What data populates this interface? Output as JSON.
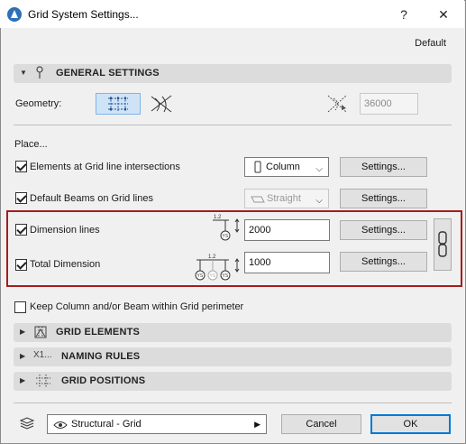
{
  "window": {
    "title": "Grid System Settings...",
    "help": "?",
    "close": "✕"
  },
  "header": {
    "favorite": "Default"
  },
  "general": {
    "section_label": "GENERAL SETTINGS",
    "geometry_label": "Geometry:",
    "angle_value": "36000"
  },
  "place": {
    "label": "Place...",
    "rows": [
      {
        "label": "Elements at Grid line intersections",
        "checked": true,
        "select": "Column",
        "settings": "Settings..."
      },
      {
        "label": "Default Beams on Grid lines",
        "checked": true,
        "select": "Straight",
        "settings": "Settings..."
      },
      {
        "label": "Dimension lines",
        "checked": true,
        "value": "2000",
        "settings": "Settings..."
      },
      {
        "label": "Total Dimension",
        "checked": true,
        "value": "1000",
        "settings": "Settings..."
      }
    ],
    "keep_label": "Keep Column and/or Beam within Grid perimeter"
  },
  "sections": [
    {
      "label": "GRID ELEMENTS"
    },
    {
      "label": "NAMING RULES"
    },
    {
      "label": "GRID POSITIONS"
    }
  ],
  "footer": {
    "layer": "Structural - Grid",
    "cancel": "Cancel",
    "ok": "OK"
  },
  "icons": {
    "dim_small": "1.2",
    "ys": "YS"
  },
  "colors": {
    "highlight": "#a51c1c",
    "accent": "#0078d7",
    "geom_active": "#cfe3f7"
  }
}
